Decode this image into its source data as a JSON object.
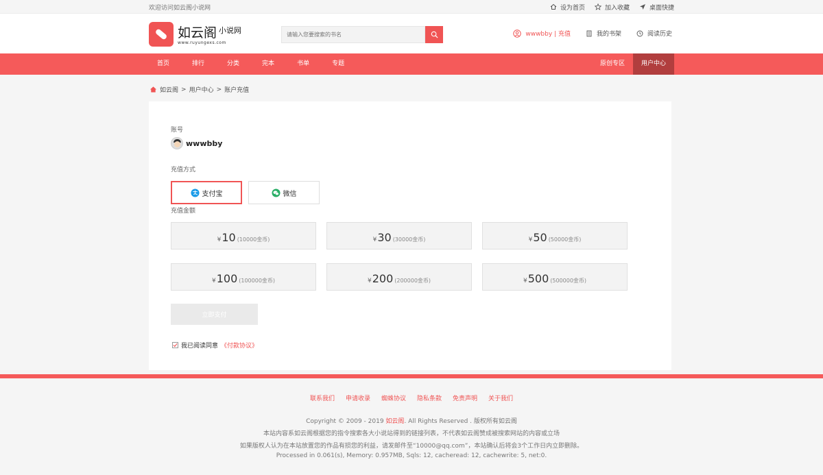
{
  "topbar": {
    "welcome": "欢迎访问如云阁小说网",
    "links": [
      "设为首页",
      "加入收藏",
      "桌面快捷"
    ]
  },
  "header": {
    "logo_name": "如云阁",
    "logo_suffix": "小说网",
    "logo_url": "www.ruyungexs.com",
    "search_placeholder": "请输入您要搜索的书名",
    "user_name": "wwwbby",
    "user_sep": " | ",
    "user_recharge": "充值",
    "bookshelf": "我的书架",
    "history": "阅读历史"
  },
  "nav": {
    "left": [
      "首页",
      "排行",
      "分类",
      "完本",
      "书单",
      "专题"
    ],
    "right": [
      "原创专区",
      "用户中心"
    ],
    "active": "用户中心"
  },
  "breadcrumb": {
    "items": [
      "如云阁",
      "用户中心",
      "账户充值"
    ],
    "sep": ">"
  },
  "panel": {
    "account_label": "账号",
    "account_name": "wwwbby",
    "method_label": "充值方式",
    "methods": [
      {
        "label": "支付宝",
        "selected": true
      },
      {
        "label": "微信",
        "selected": false
      }
    ],
    "amount_label": "充值金额",
    "currency": "¥",
    "amounts": [
      {
        "value": "10",
        "coins": "(10000金币)"
      },
      {
        "value": "30",
        "coins": "(30000金币)"
      },
      {
        "value": "50",
        "coins": "(50000金币)"
      },
      {
        "value": "100",
        "coins": "(100000金币)"
      },
      {
        "value": "200",
        "coins": "(200000金币)"
      },
      {
        "value": "500",
        "coins": "(500000金币)"
      }
    ],
    "pay_button": "立即支付",
    "agree_text": "我已阅读同意",
    "agree_link": "《付款协议》",
    "agree_checked": true
  },
  "footer": {
    "links": [
      "联系我们",
      "申请收录",
      "蜘蛛协议",
      "隐私条款",
      "免责声明",
      "关于我们"
    ],
    "copyright_pre": "Copyright © 2009 - 2019 ",
    "copyright_site": "如云阁",
    "copyright_post": ". All Rights Reserved . 版权所有如云阁",
    "line2": "本站内容系如云阁根据您的指令搜索各大小说站得到的链接列表，不代表如云阁赞成被搜索网站的内容或立场",
    "line3": "如果版权人认为在本站放置您的作品有损您的利益，请发邮件至“10000@qq.com”，本站确认后将会3个工作日内立即删除。",
    "line4": "Processed in 0.061(s), Memory: 0.957MB, Sqls: 12, cacheread: 12, cachewrite: 5, net:0."
  },
  "colors": {
    "brand": "#f05454",
    "nav_bg": "#f55a5a",
    "nav_active": "#b13e3e"
  }
}
